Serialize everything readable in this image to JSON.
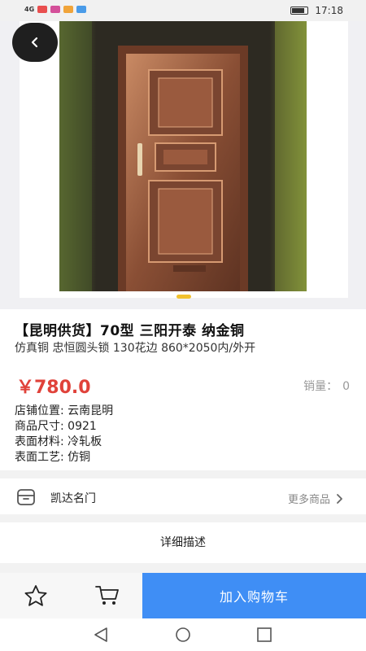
{
  "status_bar": {
    "signal": "4G",
    "time": "17:18"
  },
  "product": {
    "title": "【昆明供货】70型 三阳开泰 纳金铜",
    "subtitle": "仿真铜 忠恒圆头锁 130花边 860*2050内/外开",
    "price": "￥780.0",
    "sales_label": "销量：",
    "sales_value": "0",
    "attributes": [
      {
        "label": "店铺位置:",
        "value": "云南昆明"
      },
      {
        "label": "商品尺寸:",
        "value": "0921"
      },
      {
        "label": "表面材料:",
        "value": "冷轧板"
      },
      {
        "label": "表面工艺:",
        "value": "仿铜"
      }
    ]
  },
  "store": {
    "name": "凯达名门",
    "more_label": "更多商品"
  },
  "detail_label": "详细描述",
  "bottom_bar": {
    "add_to_cart": "加入购物车"
  },
  "colors": {
    "price": "#e0423a",
    "primary_button": "#3f8ef5",
    "indicator": "#f2c12e"
  },
  "icons": {
    "back": "chevron-left-icon",
    "store": "store-icon",
    "more": "chevron-right-icon",
    "favorite": "star-icon",
    "cart": "cart-icon"
  }
}
